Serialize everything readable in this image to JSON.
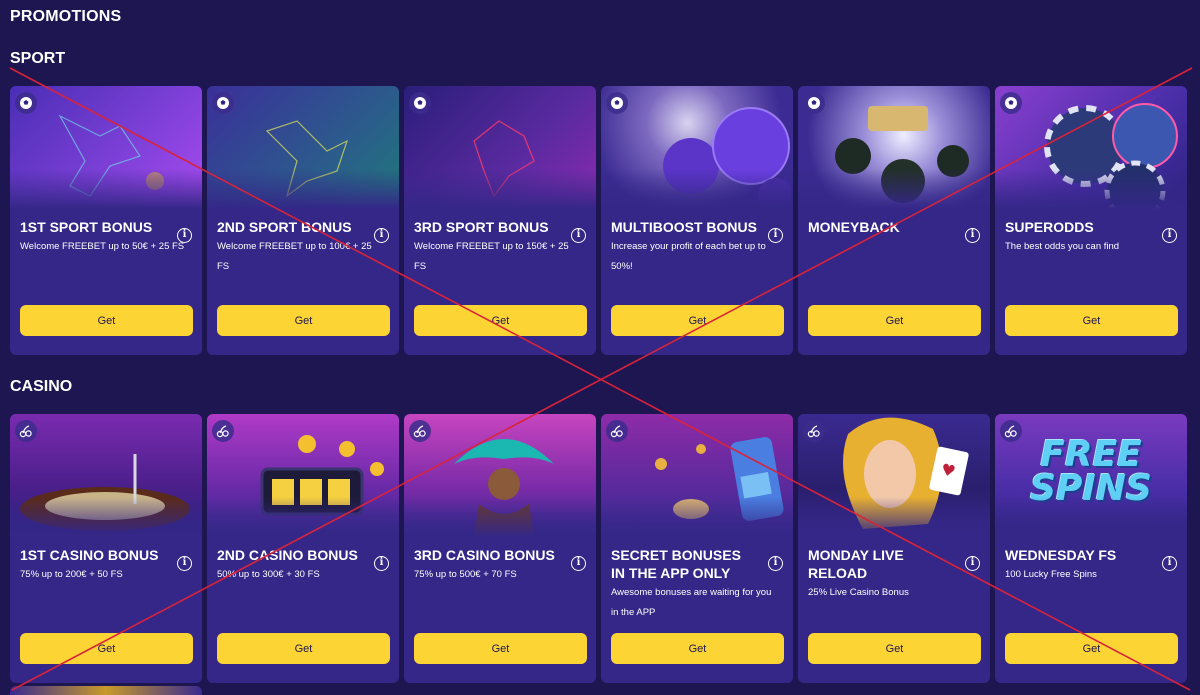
{
  "page": {
    "title": "PROMOTIONS"
  },
  "colors": {
    "background": "#1d1650",
    "card": "#342787",
    "button": "#fcd535",
    "button_text": "#1d1650",
    "cross": "#d9233a"
  },
  "sections": [
    {
      "title": "SPORT",
      "category_icon": "soccer-ball-icon",
      "cards": [
        {
          "title": "1ST SPORT BONUS",
          "desc": "Welcome FREEBET up to 50€ + 25 FS",
          "button": "Get"
        },
        {
          "title": "2ND SPORT BONUS",
          "desc": "Welcome FREEBET up to 100€ + 25 FS",
          "button": "Get"
        },
        {
          "title": "3RD SPORT BONUS",
          "desc": "Welcome FREEBET up to 150€ + 25 FS",
          "button": "Get"
        },
        {
          "title": "MULTIBOOST BONUS",
          "desc": "Increase your profit of each bet up to 50%!",
          "button": "Get"
        },
        {
          "title": "MONEYBACK",
          "desc": "",
          "button": "Get"
        },
        {
          "title": "SUPERODDS",
          "desc": "The best odds you can find",
          "button": "Get"
        }
      ]
    },
    {
      "title": "CASINO",
      "category_icon": "cherries-icon",
      "cards": [
        {
          "title": "1ST CASINO BONUS",
          "desc": "75% up to 200€ + 50 FS",
          "button": "Get"
        },
        {
          "title": "2ND CASINO BONUS",
          "desc": "50% up to 300€ + 30 FS",
          "button": "Get"
        },
        {
          "title": "3RD CASINO BONUS",
          "desc": "75% up to 500€ + 70 FS",
          "button": "Get"
        },
        {
          "title": "SECRET BONUSES IN THE APP ONLY",
          "desc": "Awesome bonuses are waiting for you in the APP",
          "button": "Get"
        },
        {
          "title": "MONDAY LIVE RELOAD",
          "desc": "25% Live Casino Bonus",
          "button": "Get"
        },
        {
          "title": "WEDNESDAY FS",
          "desc": "100 Lucky Free Spins",
          "button": "Get"
        }
      ]
    }
  ],
  "banner_text": {
    "free_spins_line1": "FREE",
    "free_spins_line2": "SPINS"
  }
}
